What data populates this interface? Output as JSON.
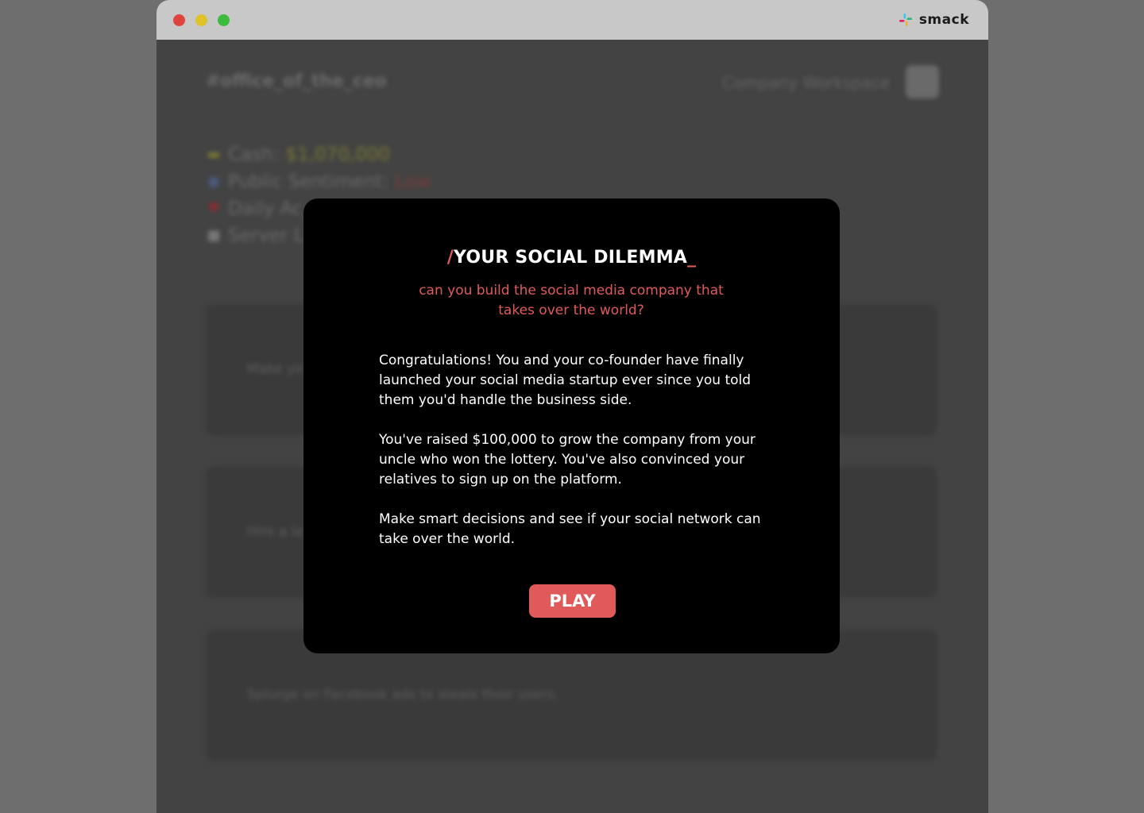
{
  "app": {
    "name": "smack",
    "logo_icon": "slack-logo-icon",
    "window_controls": {
      "close_color": "#e0443e",
      "minimize_color": "#dec22a",
      "maximize_color": "#3dbb3d"
    }
  },
  "background": {
    "channel": "#office_of_the_ceo",
    "workspace": "Company Workspace",
    "stats": [
      {
        "icon": "money-icon",
        "label": "Cash:",
        "value": "$1,070,000"
      },
      {
        "icon": "globe-icon",
        "label": "Public Sentiment:",
        "value": "Low"
      },
      {
        "icon": "heart-icon",
        "label": "Daily Ac",
        "value": ""
      },
      {
        "icon": "robot-icon",
        "label": "Server L",
        "value": ""
      }
    ],
    "cards": [
      {
        "text": "Make yo"
      },
      {
        "text": "Hire a le"
      },
      {
        "text": "Splurge on Facebook ads to steals their users."
      }
    ]
  },
  "modal": {
    "title_prefix": "/",
    "title": "YOUR SOCIAL DILEMMA",
    "title_suffix": "_",
    "subtitle": "can you build the social media company that takes over the world?",
    "paragraphs": [
      "Congratulations! You and your co-founder have finally launched your social media startup ever since you told them you'd handle the business side.",
      "You've raised $100,000 to grow the company from your uncle who won the lottery. You've also convinced your relatives to sign up on the platform.",
      "Make smart decisions and see if your social network can take over the world."
    ],
    "play_label": "PLAY",
    "accent_color": "#e05a5a"
  }
}
